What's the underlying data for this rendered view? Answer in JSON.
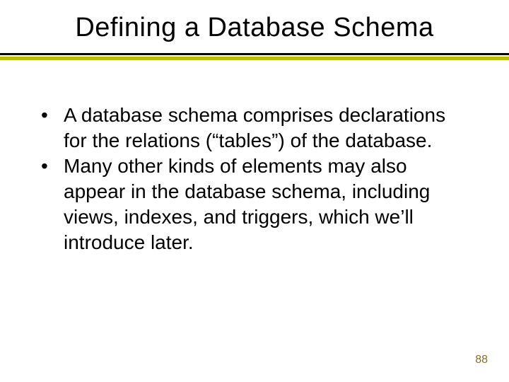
{
  "title": "Defining a Database Schema",
  "bullets": [
    "A database schema comprises declarations for the relations (“tables”) of the database.",
    "Many other kinds of elements may also appear in the database schema, including views, indexes, and triggers, which we’ll introduce later."
  ],
  "page_number": "88"
}
